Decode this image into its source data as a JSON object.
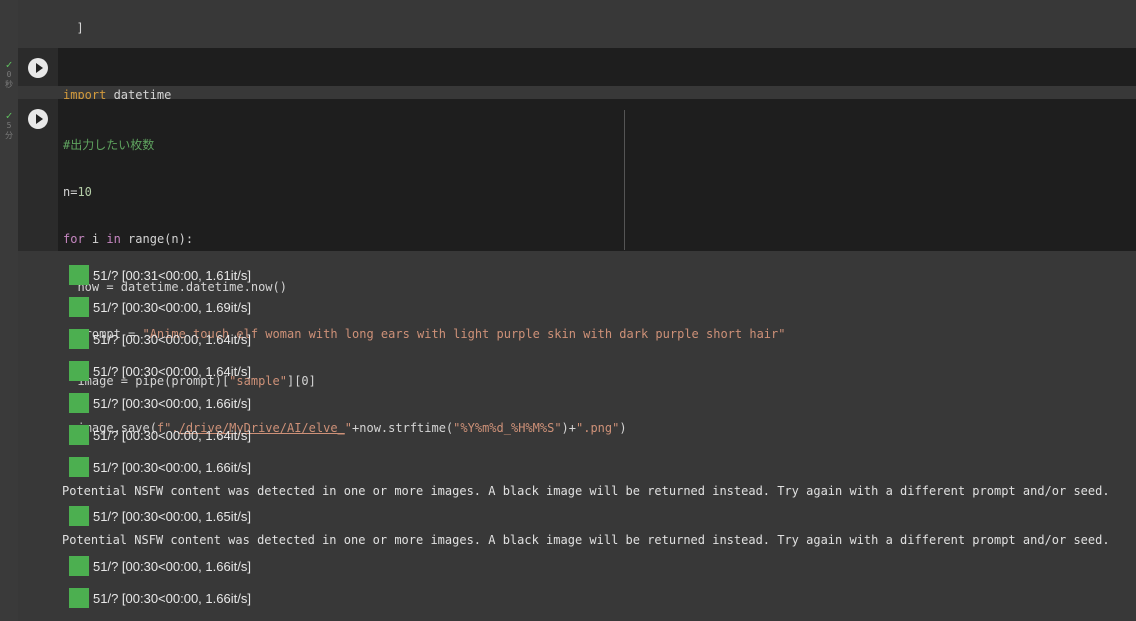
{
  "prev_cell": {
    "lines": [
      "  ]",
      "}"
    ]
  },
  "cell1": {
    "status_time_value": "0",
    "status_time_unit": "秒",
    "code": {
      "kw_import": "import",
      "mod": " datetime"
    }
  },
  "cell2": {
    "status_time_value": "5",
    "status_time_unit": "分",
    "comment": "#出力したい枚数",
    "line_n_left": "n=",
    "line_n_val": "10",
    "for_kw": "for",
    "for_mid": " i ",
    "in_kw": "in",
    "for_rest": " range(n):",
    "now_line": "  now = datetime.datetime.now()",
    "prompt_lhs": "  prompt = ",
    "prompt_str": "\"Anime touch elf woman with long ears with light purple skin with dark purple short hair\"",
    "image_lhs": "  image = pipe(prompt)[",
    "image_key": "\"sample\"",
    "image_rhs": "][0]",
    "save_lhs": "  image.save(",
    "save_f": "f\"",
    "save_dot": ".",
    "save_path": "/drive/MyDrive/AI/elve_",
    "save_q": "\"",
    "save_mid": "+now.strftime(",
    "save_fmt": "\"%Y%m%d_%H%M%S\"",
    "save_plus": ")+",
    "save_ext": "\".png\"",
    "save_end": ")"
  },
  "output": {
    "progress": [
      {
        "text": "51/? [00:31<00:00, 1.61it/s]"
      },
      {
        "text": "51/? [00:30<00:00, 1.69it/s]"
      },
      {
        "text": "51/? [00:30<00:00, 1.64it/s]"
      },
      {
        "text": "51/? [00:30<00:00, 1.64it/s]"
      },
      {
        "text": "51/? [00:30<00:00, 1.66it/s]"
      },
      {
        "text": "51/? [00:30<00:00, 1.64it/s]"
      },
      {
        "text": "51/? [00:30<00:00, 1.66it/s]"
      },
      {
        "text": "51/? [00:30<00:00, 1.65it/s]"
      },
      {
        "text": "51/? [00:30<00:00, 1.66it/s]"
      },
      {
        "text": "51/? [00:30<00:00, 1.66it/s]"
      }
    ],
    "warnings": [
      "Potential NSFW content was detected in one or more images. A black image will be returned instead. Try again with a different prompt and/or seed.",
      "Potential NSFW content was detected in one or more images. A black image will be returned instead. Try again with a different prompt and/or seed."
    ]
  },
  "colors": {
    "progress_fill": "#4caf50",
    "check": "#5fbf5f"
  }
}
